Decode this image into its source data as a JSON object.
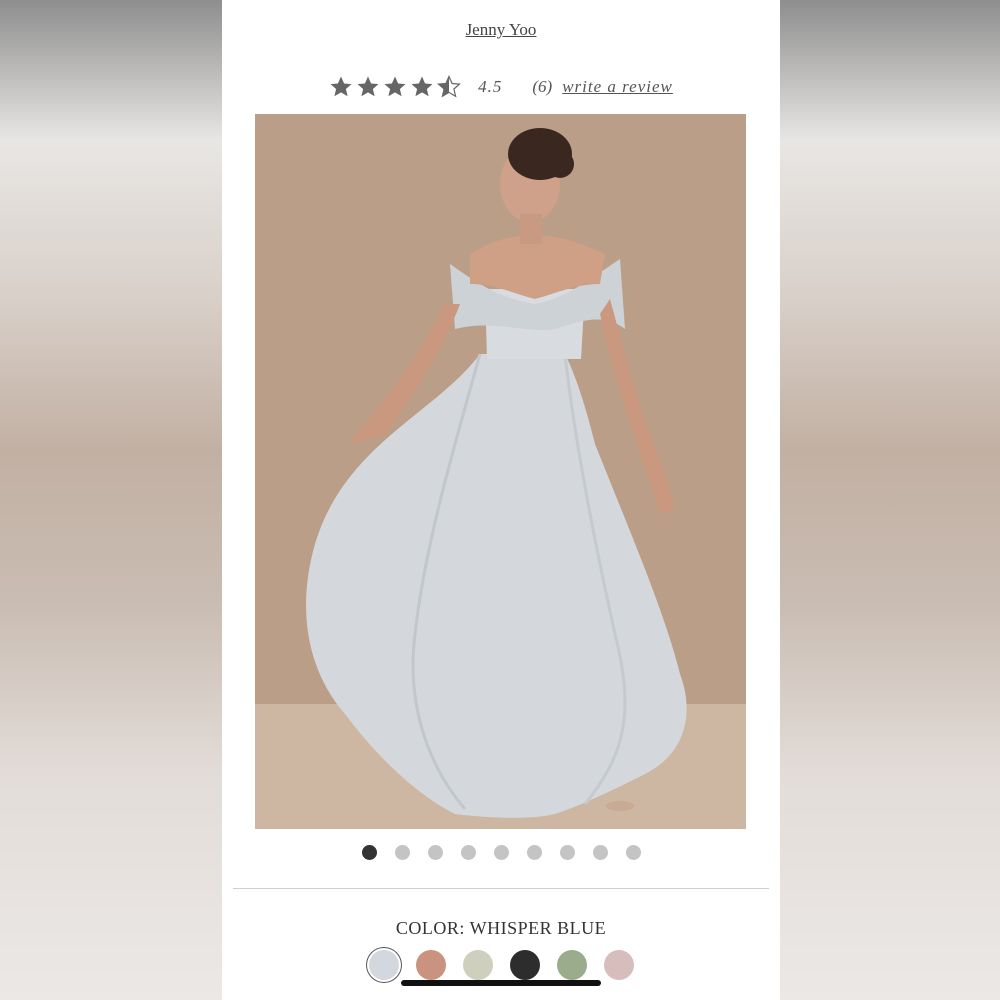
{
  "product": {
    "brand": "Jenny Yoo",
    "rating_value": "4.5",
    "rating_stars": 4.5,
    "review_count": "(6)",
    "write_review_label": "write a review"
  },
  "gallery": {
    "image_count": 9,
    "active_index": 0
  },
  "color": {
    "label": "COLOR: WHISPER BLUE",
    "swatches": [
      {
        "name": "whisper-blue",
        "hex": "#d3d8df",
        "selected": true
      },
      {
        "name": "rose",
        "hex": "#c9937f",
        "selected": false
      },
      {
        "name": "sage-cream",
        "hex": "#cfcfbd",
        "selected": false
      },
      {
        "name": "black",
        "hex": "#2e2d2d",
        "selected": false
      },
      {
        "name": "green",
        "hex": "#9aac8c",
        "selected": false
      },
      {
        "name": "blush",
        "hex": "#d8bdbd",
        "selected": false
      }
    ]
  },
  "colors": {
    "star": "#666666",
    "dot_active": "#333333",
    "dot_inactive": "#c4c4c4"
  }
}
